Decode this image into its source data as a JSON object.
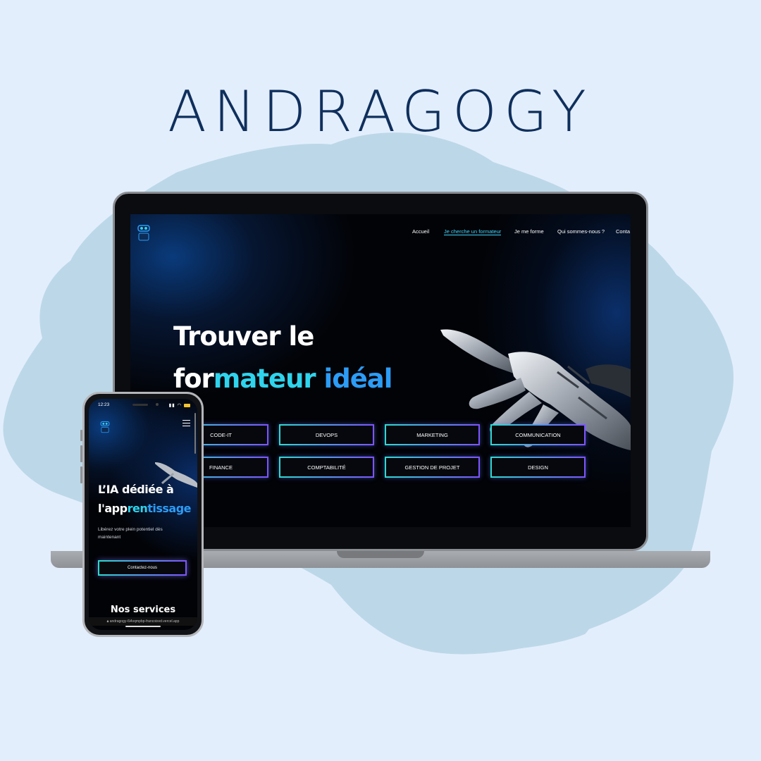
{
  "brand": {
    "title": "ANDRAGOGY"
  },
  "colors": {
    "background": "#e3eefc",
    "brand_text": "#0f2f5c",
    "accent_cyan": "#2fd3ec",
    "accent_blue": "#2c9cf6",
    "accent_purple": "#7d54ff"
  },
  "desktop": {
    "nav": [
      {
        "label": "Accueil"
      },
      {
        "label": "Je cherche un formateur"
      },
      {
        "label": "Je me forme"
      },
      {
        "label": "Qui sommes-nous ?"
      },
      {
        "label": "Conta"
      }
    ],
    "active_nav": "Je cherche un formateur",
    "hero": {
      "line1": "Trouver le",
      "line2_a": "for",
      "line2_b": "mateur ",
      "line2_c": "idéal"
    },
    "categories": [
      {
        "label": "CODE-IT"
      },
      {
        "label": "DEVOPS"
      },
      {
        "label": "MARKETING"
      },
      {
        "label": "COMMUNICATION"
      },
      {
        "label": "FINANCE"
      },
      {
        "label": "COMPTABILITÉ"
      },
      {
        "label": "GESTION DE PROJET"
      },
      {
        "label": "DESIGN"
      }
    ]
  },
  "mobile": {
    "status_time": "12:23",
    "hero": {
      "line1": "L’IA dédiée à",
      "line2_a": "l'app",
      "line2_b": "ren",
      "line2_c": "tissage"
    },
    "subtitle": "Libérez votre plein potentiel dès maintenant",
    "cta": "Contactez-nous",
    "services_title": "Nos services",
    "url": "andragogy-6i4vqmpbp-francoisvd.vercel.app"
  }
}
